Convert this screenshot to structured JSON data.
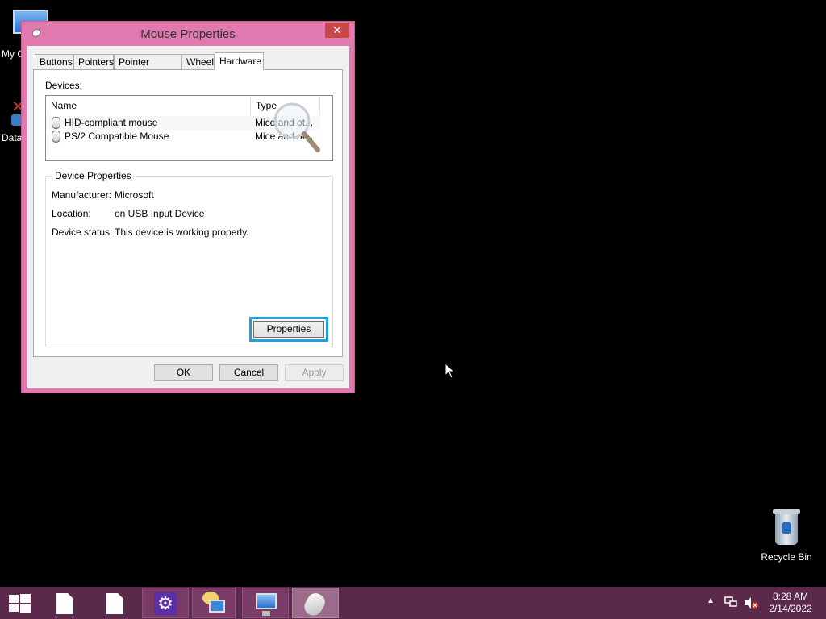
{
  "desktop": {
    "my_computer_label": "My C",
    "data_label": "Data",
    "recycle_bin_label": "Recycle Bin"
  },
  "dialog": {
    "title": "Mouse Properties",
    "close_glyph": "✕",
    "tabs": [
      {
        "label": "Buttons",
        "active": false
      },
      {
        "label": "Pointers",
        "active": false
      },
      {
        "label": "Pointer Options",
        "active": false
      },
      {
        "label": "Wheel",
        "active": false
      },
      {
        "label": "Hardware",
        "active": true
      }
    ],
    "devices_label": "Devices:",
    "device_list": {
      "columns": [
        "Name",
        "Type"
      ],
      "rows": [
        {
          "name": "HID-compliant mouse",
          "type": "Mice and ot..."
        },
        {
          "name": "PS/2 Compatible Mouse",
          "type": "Mice and ot..."
        }
      ]
    },
    "device_properties": {
      "title": "Device Properties",
      "manufacturer_label": "Manufacturer:",
      "manufacturer_value": "Microsoft",
      "location_label": "Location:",
      "location_value": "on USB Input Device",
      "status_label": "Device status:",
      "status_value": "This device is working properly.",
      "properties_button": "Properties"
    },
    "buttons": {
      "ok": "OK",
      "cancel": "Cancel",
      "apply": "Apply"
    }
  },
  "taskbar": {
    "tray_arrow": "▲",
    "time": "8:28 AM",
    "date": "2/14/2022",
    "settings_glyph": "⚙"
  },
  "colors": {
    "window_frame": "#e07ab1",
    "close_button": "#c74848",
    "focus_highlight": "#1ba1e2",
    "taskbar": "#5b2a4a"
  }
}
